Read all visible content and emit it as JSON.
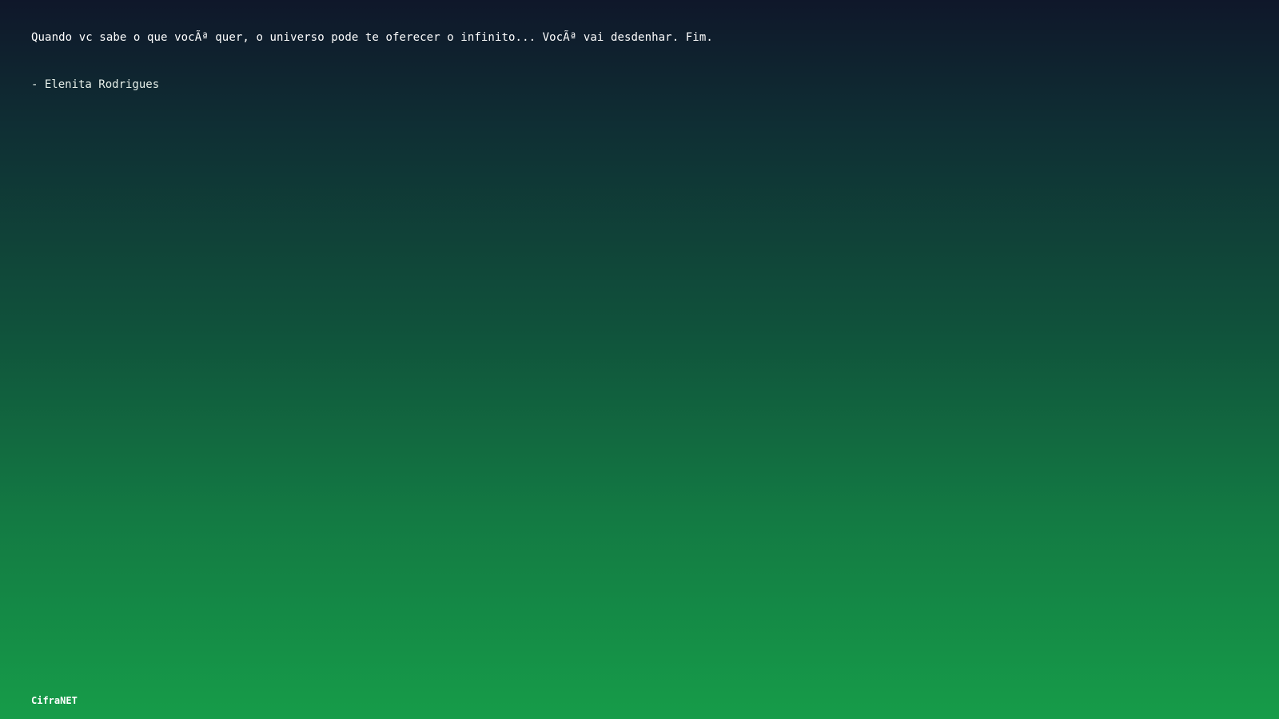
{
  "quote": {
    "text": "Quando vc sabe o que vocÃª quer, o universo pode te oferecer o infinito... VocÃª vai desdenhar. Fim.",
    "author": "- Elenita Rodrigues"
  },
  "footer": {
    "brand": "CifraNET"
  },
  "colors": {
    "background_top": "#0f172a",
    "background_bottom": "#169c49",
    "text": "#ffffff"
  }
}
